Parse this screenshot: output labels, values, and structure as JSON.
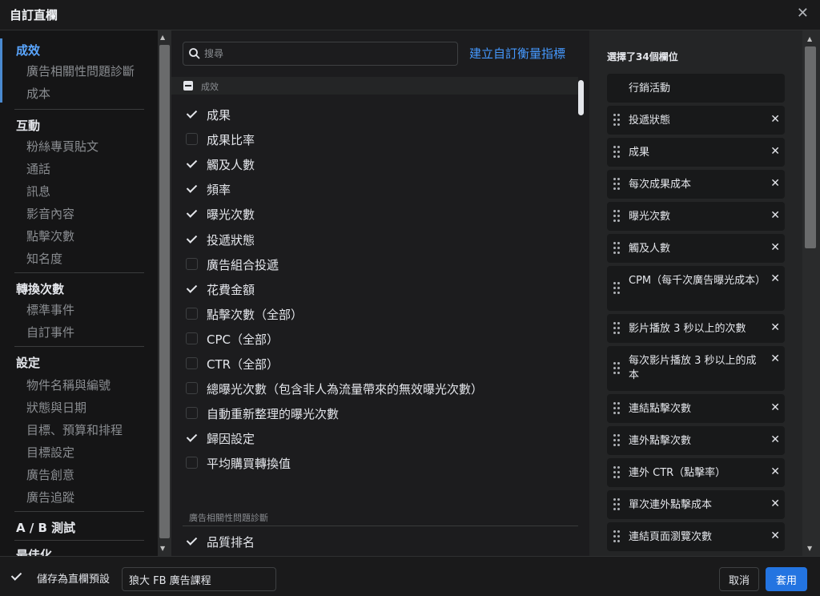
{
  "dialog": {
    "title": "自訂直欄",
    "close_icon": "close-icon"
  },
  "nav": {
    "sections": [
      {
        "title": "成效",
        "active": true,
        "items": [
          "廣告相關性問題診斷",
          "成本"
        ]
      },
      {
        "title": "互動",
        "items": [
          "粉絲專頁貼文",
          "通話",
          "訊息",
          "影音內容",
          "點擊次數",
          "知名度"
        ]
      },
      {
        "title": "轉換次數",
        "items": [
          "標準事件",
          "自訂事件"
        ]
      },
      {
        "title": "設定",
        "items": [
          "物件名稱與編號",
          "狀態與日期",
          "目標、預算和排程",
          "目標設定",
          "廣告創意",
          "廣告追蹤"
        ]
      },
      {
        "title": "A / B 測試",
        "items": []
      },
      {
        "title": "最佳化",
        "items": []
      }
    ]
  },
  "search": {
    "placeholder": "搜尋",
    "value": ""
  },
  "create_link": "建立自訂衡量指標",
  "metrics_group": {
    "title": "成效",
    "items": [
      {
        "label": "成果",
        "checked": true
      },
      {
        "label": "成果比率",
        "checked": false
      },
      {
        "label": "觸及人數",
        "checked": true
      },
      {
        "label": "頻率",
        "checked": true
      },
      {
        "label": "曝光次數",
        "checked": true
      },
      {
        "label": "投遞狀態",
        "checked": true
      },
      {
        "label": "廣告組合投遞",
        "checked": false
      },
      {
        "label": "花費金額",
        "checked": true
      },
      {
        "label": "點擊次數（全部）",
        "checked": false
      },
      {
        "label": "CPC（全部）",
        "checked": false
      },
      {
        "label": "CTR（全部）",
        "checked": false
      },
      {
        "label": "總曝光次數（包含非人為流量帶來的無效曝光次數）",
        "checked": false
      },
      {
        "label": "自動重新整理的曝光次數",
        "checked": false
      },
      {
        "label": "歸因設定",
        "checked": true
      },
      {
        "label": "平均購買轉換值",
        "checked": false
      }
    ]
  },
  "subgroup": {
    "title": "廣告相關性問題診斷",
    "items": [
      {
        "label": "品質排名",
        "checked": true
      }
    ]
  },
  "selected": {
    "count_label": "選擇了34個欄位",
    "fixed": "行銷活動",
    "items": [
      "投遞狀態",
      "成果",
      "每次成果成本",
      "曝光次數",
      "觸及人數",
      "CPM（每千次廣告曝光成本）",
      "影片播放 3 秒以上的次數",
      "每次影片播放 3 秒以上的成本",
      "連結點擊次數",
      "連外點擊次數",
      "連外 CTR（點擊率）",
      "單次連外點擊成本",
      "連結頁面瀏覽次數"
    ]
  },
  "footer": {
    "save_label": "儲存為直欄預設",
    "save_checked": true,
    "preset_value": "狼大 FB 廣告課程",
    "cancel_label": "取消",
    "apply_label": "套用"
  },
  "colors": {
    "accent": "#2374e1",
    "link": "#4599ff",
    "active_nav": "#5aa6ff"
  }
}
